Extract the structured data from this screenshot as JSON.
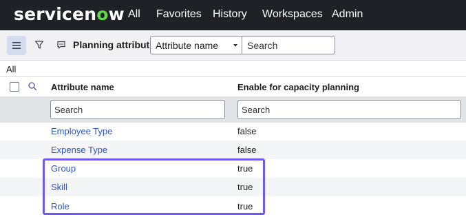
{
  "brand": {
    "logo_prefix": "servicen",
    "logo_o": "o",
    "logo_suffix": "w",
    "accent": "#62d84e"
  },
  "nav": {
    "items": [
      "All",
      "Favorites",
      "History",
      "Workspaces",
      "Admin"
    ]
  },
  "toolbar": {
    "menu_icon": "hamburger-menu-icon",
    "filter_icon": "funnel-icon",
    "chat_icon": "chat-bubble-icon",
    "title": "Planning attributes",
    "field_select": "Attribute name",
    "search_placeholder": "Search"
  },
  "breadcrumb": {
    "label": "All"
  },
  "table": {
    "columns": [
      "Attribute name",
      "Enable for capacity planning"
    ],
    "filter_placeholders": [
      "Search",
      "Search"
    ],
    "rows": [
      {
        "name": "Employee Type",
        "enabled": "false"
      },
      {
        "name": "Expense Type",
        "enabled": "false"
      },
      {
        "name": "Group",
        "enabled": "true"
      },
      {
        "name": "Skill",
        "enabled": "true"
      },
      {
        "name": "Role",
        "enabled": "true"
      }
    ]
  },
  "colors": {
    "nav_bg": "#1f2127",
    "link": "#2a55c7",
    "highlight": "#7157ec"
  }
}
